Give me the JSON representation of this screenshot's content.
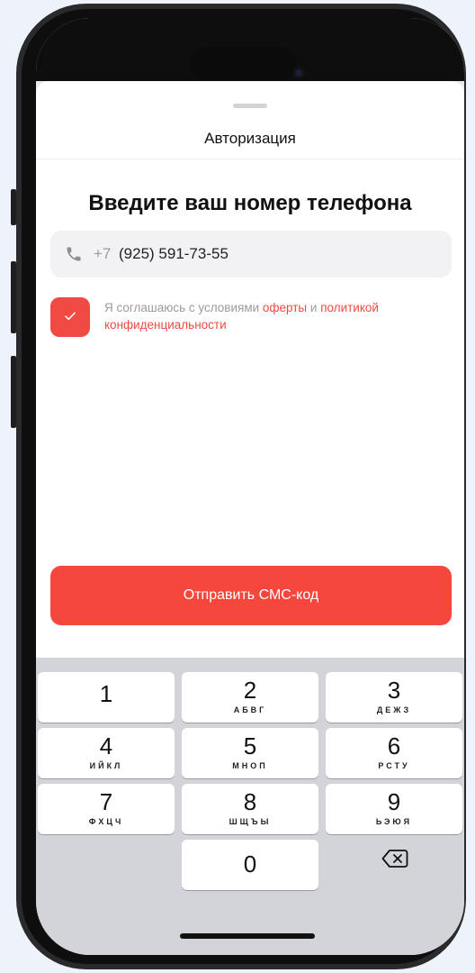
{
  "sheet": {
    "title": "Авторизация",
    "heading": "Введите ваш номер телефона"
  },
  "phone_field": {
    "icon": "phone-icon",
    "prefix": "+7",
    "value": "(925) 591-73-55"
  },
  "consent": {
    "checked": true,
    "text_before": "Я соглашаюсь с условиями ",
    "link_offer": "оферты",
    "text_and": " и ",
    "link_policy": "политикой конфиденциальности"
  },
  "send_button": {
    "label": "Отправить СМС-код"
  },
  "keypad": {
    "keys": [
      {
        "digit": "1",
        "letters": ""
      },
      {
        "digit": "2",
        "letters": "АБВГ"
      },
      {
        "digit": "3",
        "letters": "ДЕЖЗ"
      },
      {
        "digit": "4",
        "letters": "ИЙКЛ"
      },
      {
        "digit": "5",
        "letters": "МНОП"
      },
      {
        "digit": "6",
        "letters": "РСТУ"
      },
      {
        "digit": "7",
        "letters": "ФХЦЧ"
      },
      {
        "digit": "8",
        "letters": "ШЩЪЫ"
      },
      {
        "digit": "9",
        "letters": "ЬЭЮЯ"
      },
      {
        "digit": "0",
        "letters": ""
      }
    ],
    "delete_icon": "delete-backspace-icon"
  },
  "colors": {
    "accent": "#f5473e",
    "background": "#eef2fb",
    "keyboard": "#d3d4d9"
  }
}
